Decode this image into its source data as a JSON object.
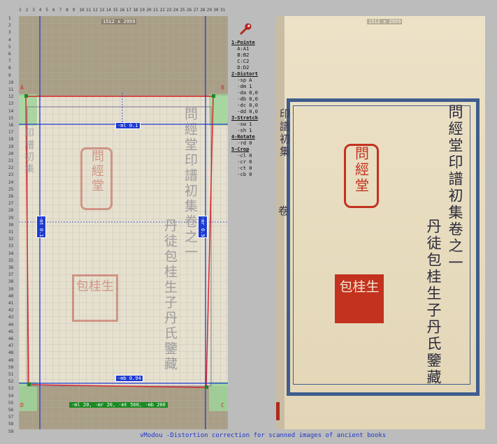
{
  "ruler_top": [
    "1",
    "2",
    "3",
    "4",
    "5",
    "6",
    "7",
    "8",
    "9",
    "10",
    "11",
    "12",
    "13",
    "14",
    "15",
    "16",
    "17",
    "18",
    "19",
    "20",
    "21",
    "22",
    "23",
    "24",
    "25",
    "26",
    "27",
    "28",
    "29",
    "30",
    "31"
  ],
  "ruler_side": [
    "1",
    "2",
    "3",
    "4",
    "5",
    "6",
    "7",
    "8",
    "9",
    "10",
    "11",
    "12",
    "13",
    "14",
    "15",
    "16",
    "17",
    "18",
    "19",
    "20",
    "21",
    "22",
    "23",
    "24",
    "25",
    "26",
    "27",
    "28",
    "29",
    "30",
    "31",
    "32",
    "33",
    "34",
    "35",
    "36",
    "37",
    "38",
    "39",
    "40",
    "41",
    "42",
    "43",
    "44",
    "45",
    "46",
    "47",
    "48",
    "49",
    "50",
    "51",
    "52",
    "53",
    "54",
    "55",
    "56",
    "57",
    "58",
    "59"
  ],
  "left": {
    "dimension": "1512 x 2959",
    "corners": {
      "a": "A",
      "b": "B",
      "c": "C",
      "d": "D"
    },
    "ml_label": "-ml 0.1",
    "mt_label": "-mt 0.1",
    "mr_label": "-mr 0.9",
    "mb_label": "-mb 0.94",
    "margins_label": "-ml 20, -mr 20, -mt 560, -mb 200"
  },
  "right": {
    "dimension": "1512 x 2959"
  },
  "book": {
    "title": "問經堂印譜初集卷之一",
    "line2": "丹徒包桂生子丹氏鑒藏",
    "seal1": "問經堂",
    "seal2": "包桂生",
    "margin_char": "卷",
    "left_strip": "印譜初集"
  },
  "commands": [
    {
      "text": "1-Pointe",
      "head": true
    },
    {
      "text": "  A:A1",
      "head": false
    },
    {
      "text": "  B:B2",
      "head": false
    },
    {
      "text": "  C:C2",
      "head": false
    },
    {
      "text": "  D:D2",
      "head": false
    },
    {
      "text": "2-Distort",
      "head": true
    },
    {
      "text": "  -sp A",
      "head": false
    },
    {
      "text": "  -dm 1",
      "head": false
    },
    {
      "text": "  -da 0,0",
      "head": false
    },
    {
      "text": "  -db 0,0",
      "head": false
    },
    {
      "text": "  -dc 0,0",
      "head": false
    },
    {
      "text": "  -dd 0,0",
      "head": false
    },
    {
      "text": "3-Stretch",
      "head": true
    },
    {
      "text": "  -sw 1",
      "head": false
    },
    {
      "text": "  -sh 1",
      "head": false
    },
    {
      "text": "4-Rotate",
      "head": true
    },
    {
      "text": "  -rd 0",
      "head": false
    },
    {
      "text": "5-Crop",
      "head": true
    },
    {
      "text": "  -cl 0",
      "head": false
    },
    {
      "text": "  -cr 0",
      "head": false
    },
    {
      "text": "  -ct 0",
      "head": false
    },
    {
      "text": "  -cb 0",
      "head": false
    }
  ],
  "footer": "vModou -Distortion correction for scanned images of ancient books",
  "colors": {
    "accent": "#1d3bd1",
    "red": "#d8262a",
    "green": "#1a8a22",
    "seal": "#b2291b"
  }
}
